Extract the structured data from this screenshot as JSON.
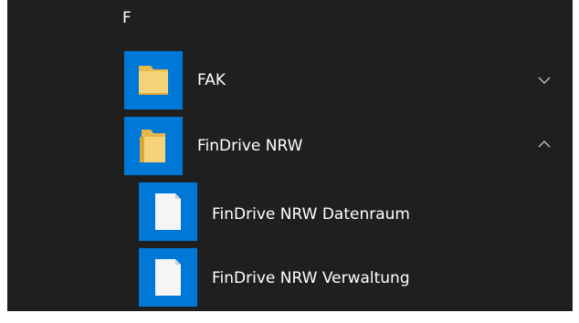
{
  "start_menu": {
    "section_letter": "F",
    "items": [
      {
        "label": "FAK",
        "icon": "folder-icon",
        "expanded": false,
        "chevron": "chevron-down-icon"
      },
      {
        "label": "FinDrive NRW",
        "icon": "folder-open-icon",
        "expanded": true,
        "chevron": "chevron-up-icon"
      }
    ],
    "subitems": [
      {
        "label": "FinDrive NRW Datenraum",
        "icon": "document-icon"
      },
      {
        "label": "FinDrive NRW Verwaltung",
        "icon": "document-icon"
      }
    ]
  },
  "colors": {
    "background": "#1f1f1f",
    "tile": "#0078d7",
    "text": "#ffffff",
    "folder": "#f4d37a",
    "chevron": "#bfbfbf"
  }
}
